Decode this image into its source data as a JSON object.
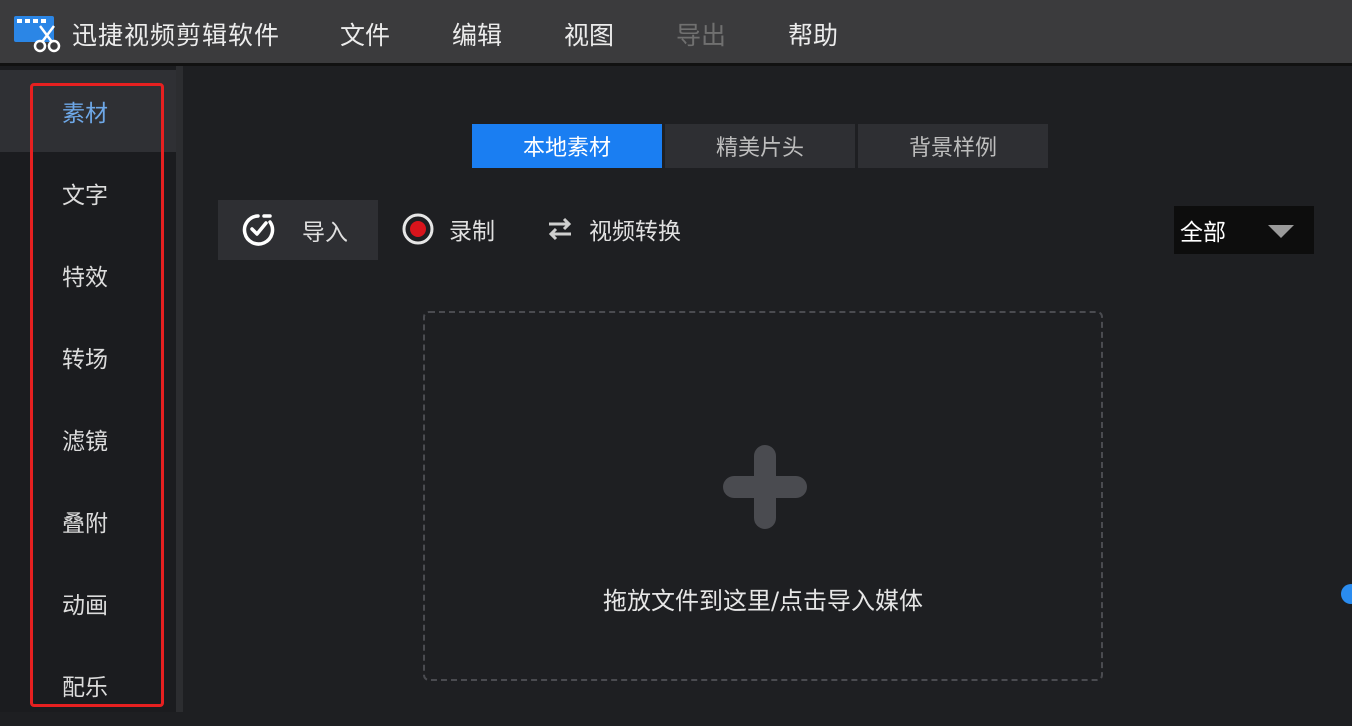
{
  "app": {
    "title": "迅捷视频剪辑软件"
  },
  "menu": [
    {
      "label": "文件",
      "enabled": true
    },
    {
      "label": "编辑",
      "enabled": true
    },
    {
      "label": "视图",
      "enabled": true
    },
    {
      "label": "导出",
      "enabled": false
    },
    {
      "label": "帮助",
      "enabled": true
    }
  ],
  "sidebar": {
    "active": "素材",
    "items": [
      "素材",
      "文字",
      "特效",
      "转场",
      "滤镜",
      "叠附",
      "动画",
      "配乐"
    ]
  },
  "tabs": {
    "active": "本地素材",
    "items": [
      "本地素材",
      "精美片头",
      "背景样例"
    ]
  },
  "toolbar": {
    "import_label": "导入",
    "record_label": "录制",
    "convert_label": "视频转换"
  },
  "filter": {
    "selected": "全部"
  },
  "dropzone": {
    "hint": "拖放文件到这里/点击导入媒体"
  },
  "colors": {
    "accent": "#1a7ef2",
    "record": "#d8141c",
    "highlight_box": "#e62020",
    "active_sidebar_text": "#6ea8e8"
  }
}
